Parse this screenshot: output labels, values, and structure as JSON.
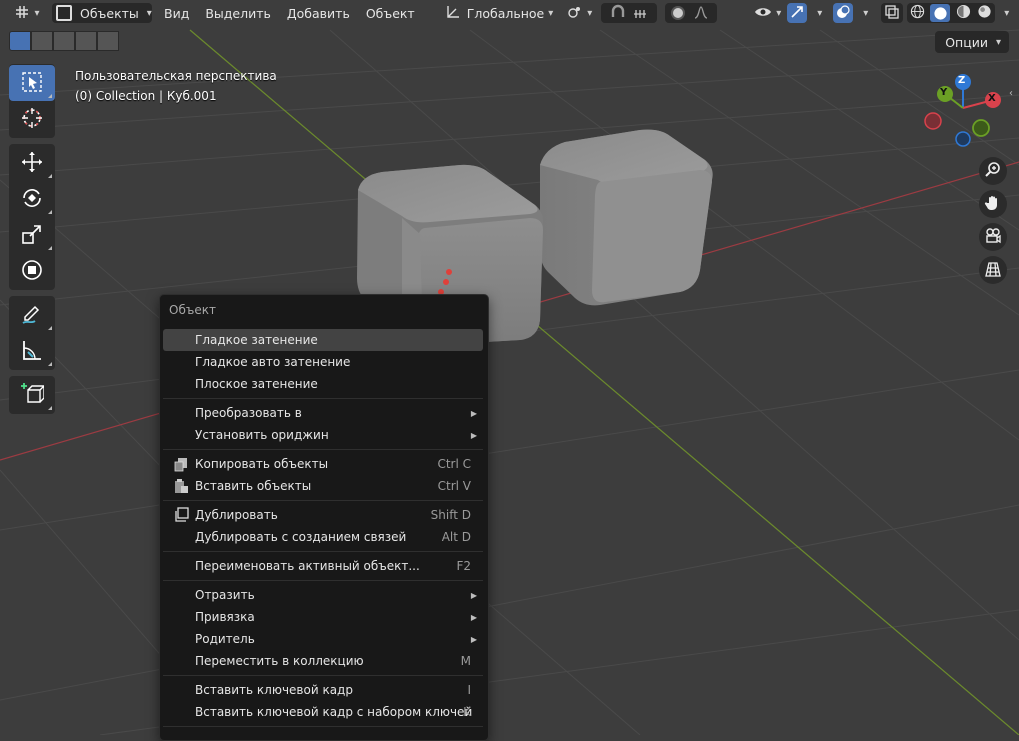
{
  "header": {
    "mode_label": "Объекты",
    "menus": [
      "Вид",
      "Выделить",
      "Добавить",
      "Объект"
    ],
    "orientation_label": "Глобальное"
  },
  "options_label": "Опции",
  "viewport": {
    "view_name": "Пользовательская перспектива",
    "collection_info": "(0) Collection | Куб.001"
  },
  "gizmo": {
    "x": "X",
    "y": "Y",
    "z": "Z"
  },
  "colors": {
    "accent": "#4772b3",
    "x_axis": "#d9424c",
    "y_axis": "#6ba025",
    "z_axis": "#2f79d6",
    "annotation_arrow": "#e0403a"
  },
  "icons": {
    "header": [
      "editor-type-icon",
      "object-mode-icon",
      "transform-orientation-icon",
      "pivot-icon",
      "snap-icon",
      "proportional-editing-icon",
      "visibility-icon",
      "gizmo-icon",
      "overlay-icon",
      "xray-icon",
      "shading-wireframe-icon",
      "shading-solid-icon",
      "shading-material-icon",
      "shading-rendered-icon"
    ],
    "tools": [
      "select-box-icon",
      "cursor-icon",
      "move-icon",
      "rotate-icon",
      "scale-icon",
      "transform-icon",
      "annotate-icon",
      "measure-icon",
      "add-cube-icon"
    ],
    "nav": [
      "zoom-icon",
      "hand-pan-icon",
      "camera-icon",
      "grid-perspective-icon"
    ]
  },
  "menu": {
    "title": "Объект",
    "items": [
      {
        "label": "Гладкое затенение",
        "shortcut": ""
      },
      {
        "label": "Гладкое авто затенение",
        "shortcut": ""
      },
      {
        "label": "Плоское затенение",
        "shortcut": ""
      },
      {
        "label": "Преобразовать в",
        "shortcut": ""
      },
      {
        "label": "Установить ориджин",
        "shortcut": ""
      },
      {
        "label": "Копировать объекты",
        "shortcut": "Ctrl C"
      },
      {
        "label": "Вставить объекты",
        "shortcut": "Ctrl V"
      },
      {
        "label": "Дублировать",
        "shortcut": "Shift D"
      },
      {
        "label": "Дублировать с созданием связей",
        "shortcut": "Alt D"
      },
      {
        "label": "Переименовать активный объект...",
        "shortcut": "F2"
      },
      {
        "label": "Отразить",
        "shortcut": ""
      },
      {
        "label": "Привязка",
        "shortcut": ""
      },
      {
        "label": "Родитель",
        "shortcut": ""
      },
      {
        "label": "Переместить в коллекцию",
        "shortcut": "M"
      },
      {
        "label": "Вставить ключевой кадр",
        "shortcut": "I"
      },
      {
        "label": "Вставить ключевой кадр с набором ключей",
        "shortcut": "K"
      }
    ]
  }
}
